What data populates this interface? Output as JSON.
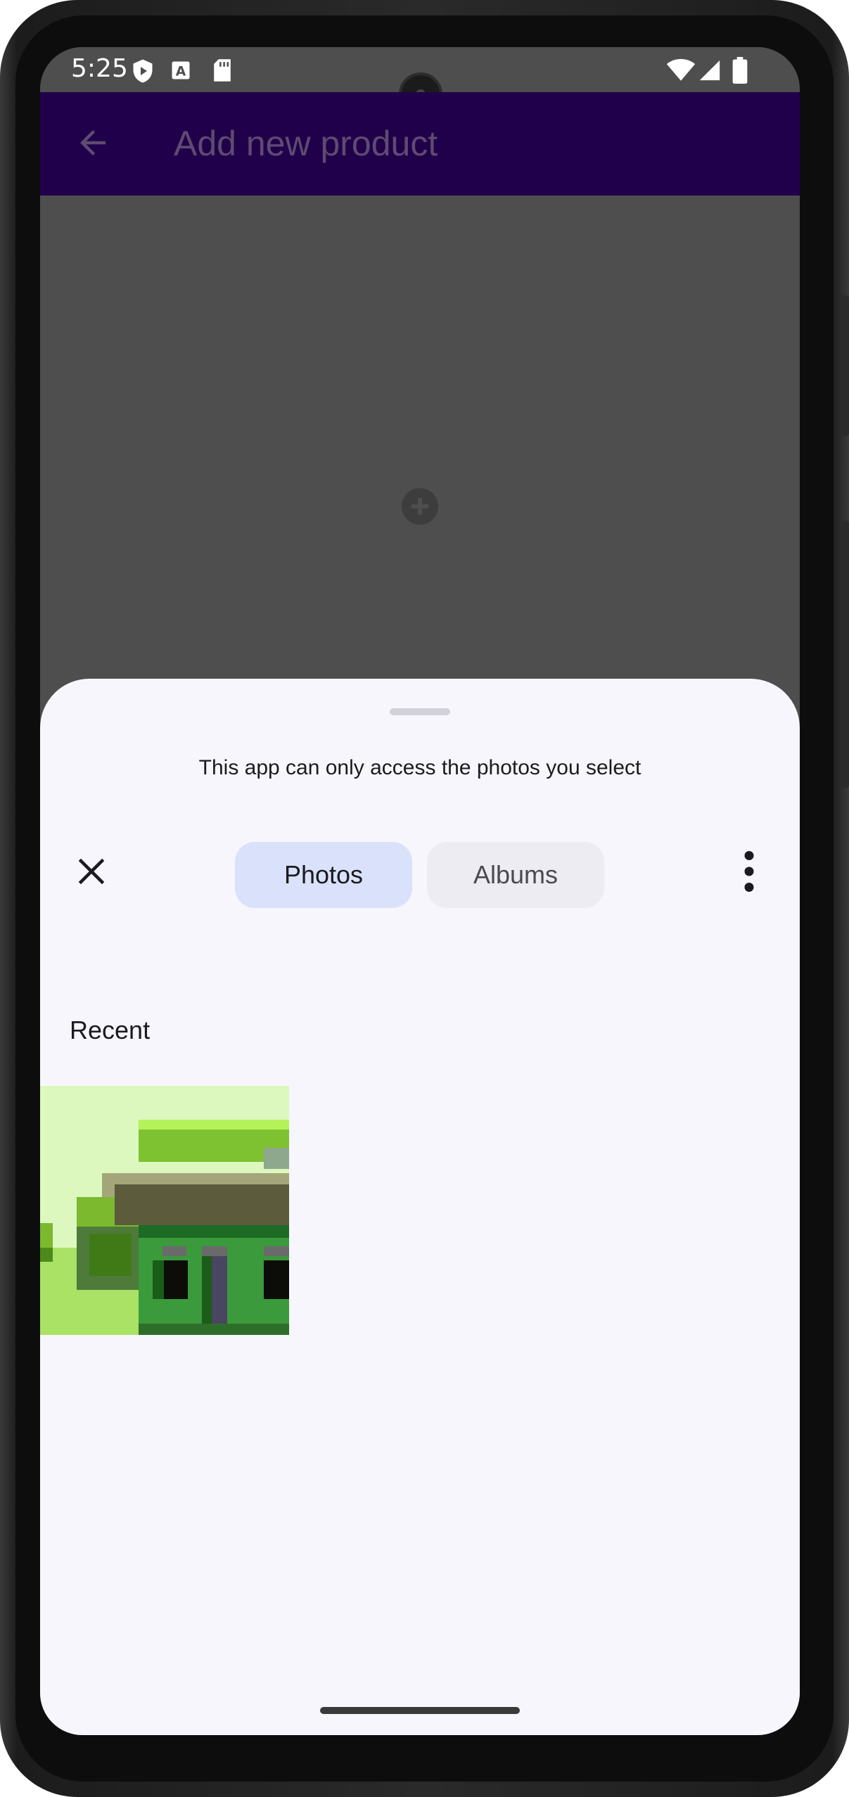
{
  "status_bar": {
    "time": "5:25",
    "left_icons": [
      "shield-play-icon",
      "keyboard-a-icon",
      "sd-card-icon"
    ],
    "right_icons": [
      "wifi-icon",
      "cellular-signal-icon",
      "battery-icon"
    ]
  },
  "app_bar": {
    "title": "Add new product",
    "back_icon": "arrow-back-icon",
    "background": "#21004b"
  },
  "content": {
    "add_icon": "add-circle-icon"
  },
  "photo_picker": {
    "notice": "This app can only access the photos you select",
    "tabs": [
      {
        "label": "Photos",
        "selected": true
      },
      {
        "label": "Albums",
        "selected": false
      }
    ],
    "close_icon": "close-icon",
    "more_icon": "more-vert-icon",
    "section_title": "Recent",
    "items": [
      {
        "type": "photo",
        "description_icon": "pixel-house-thumbnail"
      }
    ],
    "colors": {
      "sheet_background": "#f7f6fc",
      "selected_tab": "#dae2fb",
      "unselected_tab": "#edecf2"
    }
  }
}
